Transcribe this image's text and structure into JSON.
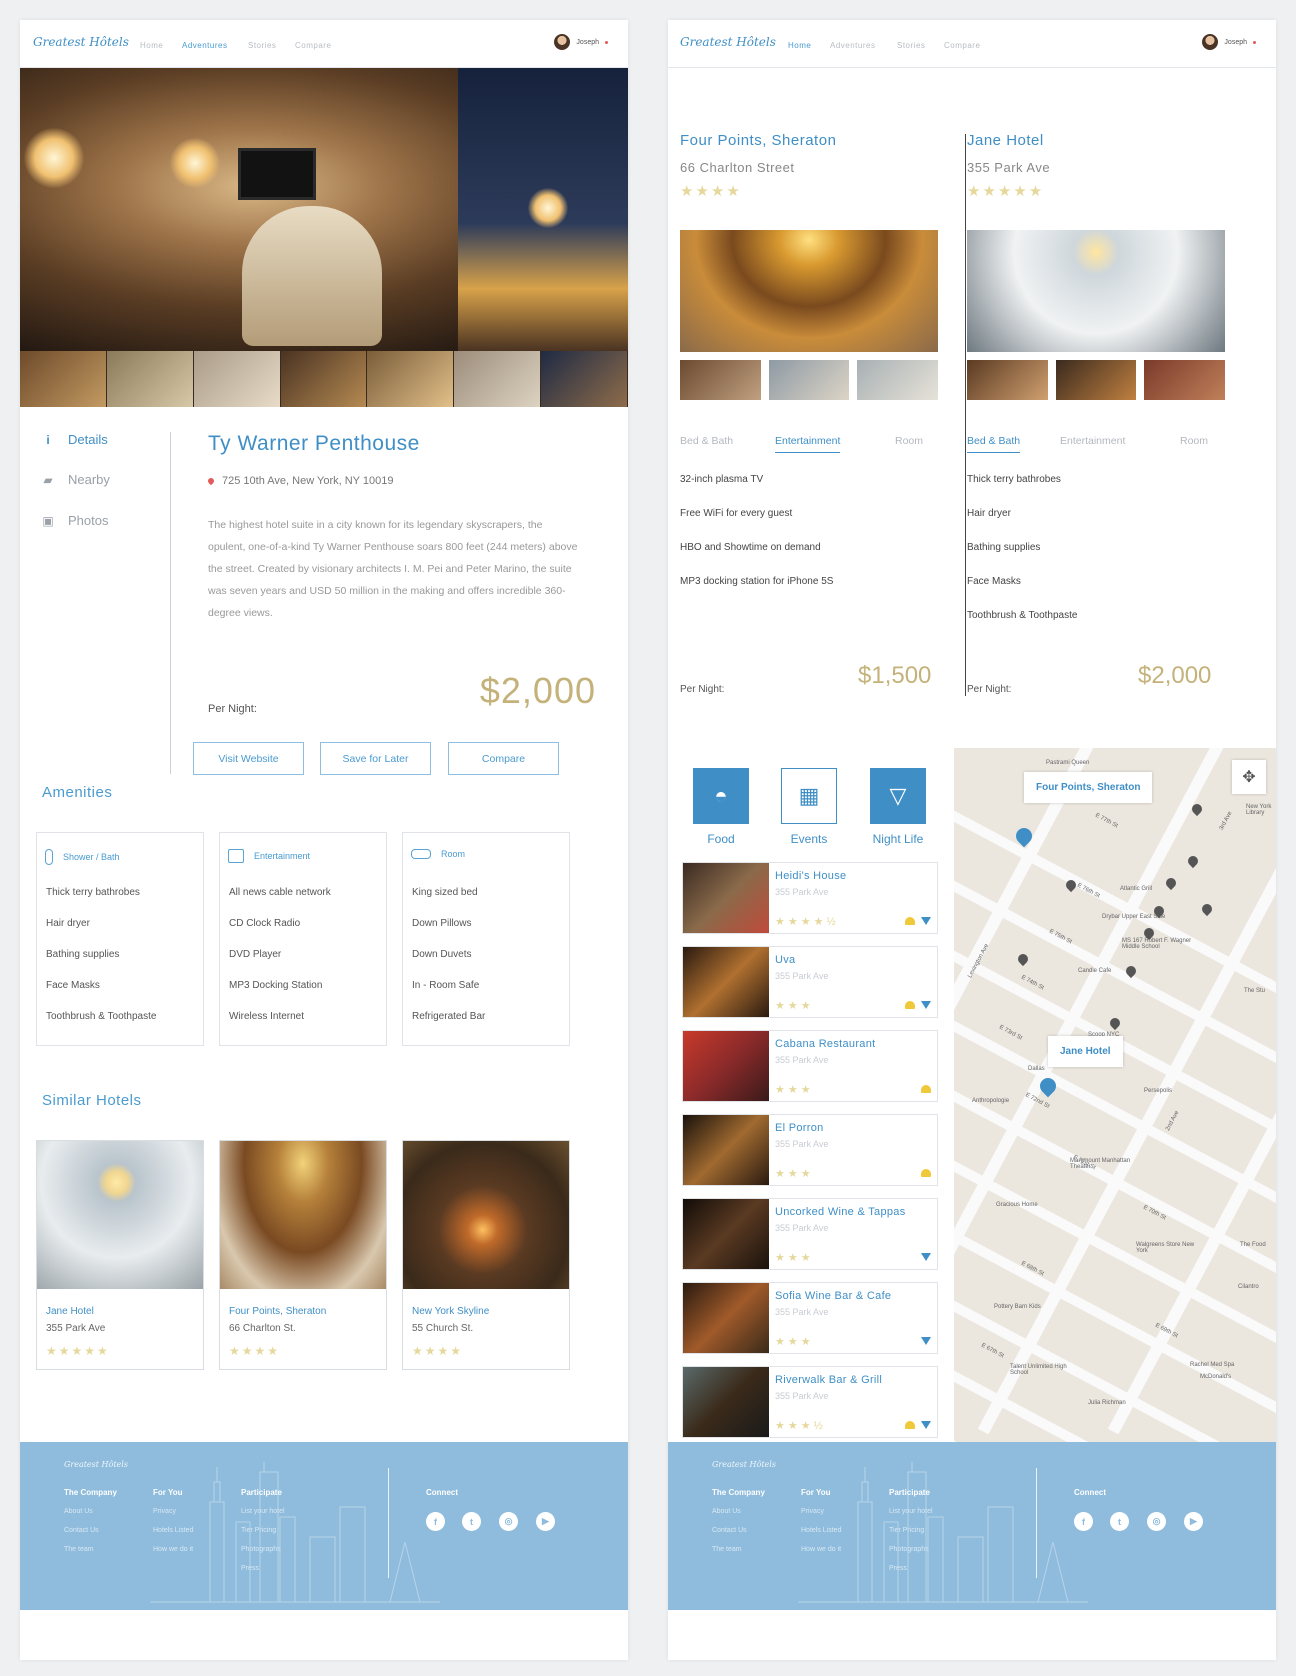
{
  "left": {
    "nav": {
      "logo": "Greatest Hôtels",
      "links": [
        "Home",
        "Adventures",
        "Stories",
        "Compare"
      ],
      "active": "Adventures",
      "user": "Joseph"
    },
    "sidebar": [
      {
        "label": "Details",
        "icon": "info-icon",
        "active": true
      },
      {
        "label": "Nearby",
        "icon": "map-book-icon",
        "active": false
      },
      {
        "label": "Photos",
        "icon": "photo-icon",
        "active": false
      }
    ],
    "hotel": {
      "name": "Ty Warner Penthouse",
      "address": "725 10th Ave, New York, NY 10019",
      "description": "The highest hotel suite in a city known for its legendary skyscrapers, the opulent, one-of-a-kind Ty Warner Penthouse soars 800 feet (244 meters) above the street. Created by visionary architects I. M. Pei and Peter Marino, the suite was seven years and USD 50 million in the making and offers incredible 360-degree views.",
      "per_night_label": "Per Night:",
      "price": "$2,000",
      "buttons": [
        "Visit Website",
        "Save for Later",
        "Compare"
      ]
    },
    "amenities": {
      "title": "Amenities",
      "cards": [
        {
          "title": "Shower / Bath",
          "icon": "shower-icon",
          "items": [
            "Thick terry bathrobes",
            "Hair dryer",
            "Bathing supplies",
            "Face Masks",
            "Toothbrush & Toothpaste"
          ]
        },
        {
          "title": "Entertainment",
          "icon": "tv-icon",
          "items": [
            "All news cable network",
            "CD Clock Radio",
            "DVD Player",
            "MP3 Docking Station",
            "Wireless Internet"
          ]
        },
        {
          "title": "Room",
          "icon": "bed-icon",
          "items": [
            "King sized bed",
            "Down Pillows",
            "Down Duvets",
            "In - Room Safe",
            "Refrigerated Bar"
          ]
        }
      ]
    },
    "similar": {
      "title": "Similar Hotels",
      "hotels": [
        {
          "name": "Jane Hotel",
          "address": "355 Park Ave",
          "stars": "★★★★★"
        },
        {
          "name": "Four Points, Sheraton",
          "address": "66 Charlton St.",
          "stars": "★★★★"
        },
        {
          "name": "New York Skyline",
          "address": "55 Church St.",
          "stars": "★★★★"
        }
      ]
    }
  },
  "right": {
    "nav": {
      "logo": "Greatest Hôtels",
      "links": [
        "Home",
        "Adventures",
        "Stories",
        "Compare"
      ],
      "active": "Home",
      "user": "Joseph"
    },
    "compare": [
      {
        "name": "Four Points, Sheraton",
        "address": "66 Charlton Street",
        "stars": "★★★★",
        "tabs": [
          "Bed & Bath",
          "Entertainment",
          "Room"
        ],
        "active_tab": "Entertainment",
        "features": [
          "32-inch plasma TV",
          "Free WiFi for every guest",
          "HBO and Showtime on demand",
          "MP3 docking station for iPhone 5S"
        ],
        "per_night_label": "Per Night:",
        "price": "$1,500"
      },
      {
        "name": "Jane Hotel",
        "address": "355 Park Ave",
        "stars": "★★★★★",
        "tabs": [
          "Bed & Bath",
          "Entertainment",
          "Room"
        ],
        "active_tab": "Bed & Bath",
        "features": [
          "Thick terry bathrobes",
          "Hair dryer",
          "Bathing supplies",
          "Face Masks",
          "Toothbrush & Toothpaste"
        ],
        "per_night_label": "Per Night:",
        "price": "$2,000"
      }
    ],
    "categories": [
      {
        "label": "Food",
        "icon": "burger-icon"
      },
      {
        "label": "Events",
        "icon": "calendar-icon"
      },
      {
        "label": "Night Life",
        "icon": "cocktail-icon"
      }
    ],
    "places": [
      {
        "name": "Heidi's House",
        "address": "355 Park Ave",
        "stars": "★★★★½",
        "food": true,
        "drink": true
      },
      {
        "name": "Uva",
        "address": "355 Park Ave",
        "stars": "★★★",
        "food": true,
        "drink": true
      },
      {
        "name": "Cabana Restaurant",
        "address": "355 Park Ave",
        "stars": "★★★",
        "food": true,
        "drink": false
      },
      {
        "name": "El Porron",
        "address": "355 Park Ave",
        "stars": "★★★",
        "food": true,
        "drink": false
      },
      {
        "name": "Uncorked Wine & Tappas",
        "address": "355 Park Ave",
        "stars": "★★★",
        "food": false,
        "drink": true
      },
      {
        "name": "Sofia Wine Bar & Cafe",
        "address": "355 Park Ave",
        "stars": "★★★",
        "food": false,
        "drink": true
      },
      {
        "name": "Riverwalk Bar & Grill",
        "address": "355 Park Ave",
        "stars": "★★★½",
        "food": true,
        "drink": true
      }
    ],
    "map": {
      "labels": [
        "Four Points, Sheraton",
        "Jane Hotel"
      ],
      "streets": [
        "E 77th St",
        "E 76th St",
        "E 75th St",
        "E 74th St",
        "E 73rd St",
        "E 72nd St",
        "E 71st St",
        "E 70th St",
        "E 69th St",
        "E 68th St",
        "E 67th St",
        "Lexington Ave",
        "3rd Ave",
        "2nd Ave"
      ],
      "places": [
        "Pastrami Queen",
        "Atlantic Grill",
        "Drybar Upper East Side",
        "MS 167 Robert F. Wagner Middle School",
        "Candle Cafe",
        "Persepolis",
        "Anthropologie",
        "Marymount Manhattan Theater",
        "Gracious Home",
        "Walgreens Store New York",
        "Pottery Barn Kids",
        "Talent Unlimited High School",
        "Julia Richman",
        "Rachel Med Spa",
        "McDonald's",
        "The Food",
        "Cilantro",
        "New York Library",
        "Dallas",
        "Scoop NYC",
        "The Stu"
      ]
    }
  },
  "footer": {
    "logo": "Greatest Hôtels",
    "columns": [
      {
        "title": "The Company",
        "links": [
          "About Us",
          "Contact Us",
          "The team"
        ]
      },
      {
        "title": "For You",
        "links": [
          "Privacy",
          "Hotels Listed",
          "How we do it"
        ]
      },
      {
        "title": "Participate",
        "links": [
          "List your hotel",
          "Tier Pricing",
          "Photographs",
          "Press"
        ]
      }
    ],
    "connect": "Connect",
    "social": [
      "facebook-icon",
      "twitter-icon",
      "instagram-icon",
      "youtube-icon"
    ]
  },
  "colors": {
    "accent": "#3f8fc6",
    "price": "#c4b27a",
    "footer": "#8fbcdc",
    "stars": "#e6d89c"
  }
}
